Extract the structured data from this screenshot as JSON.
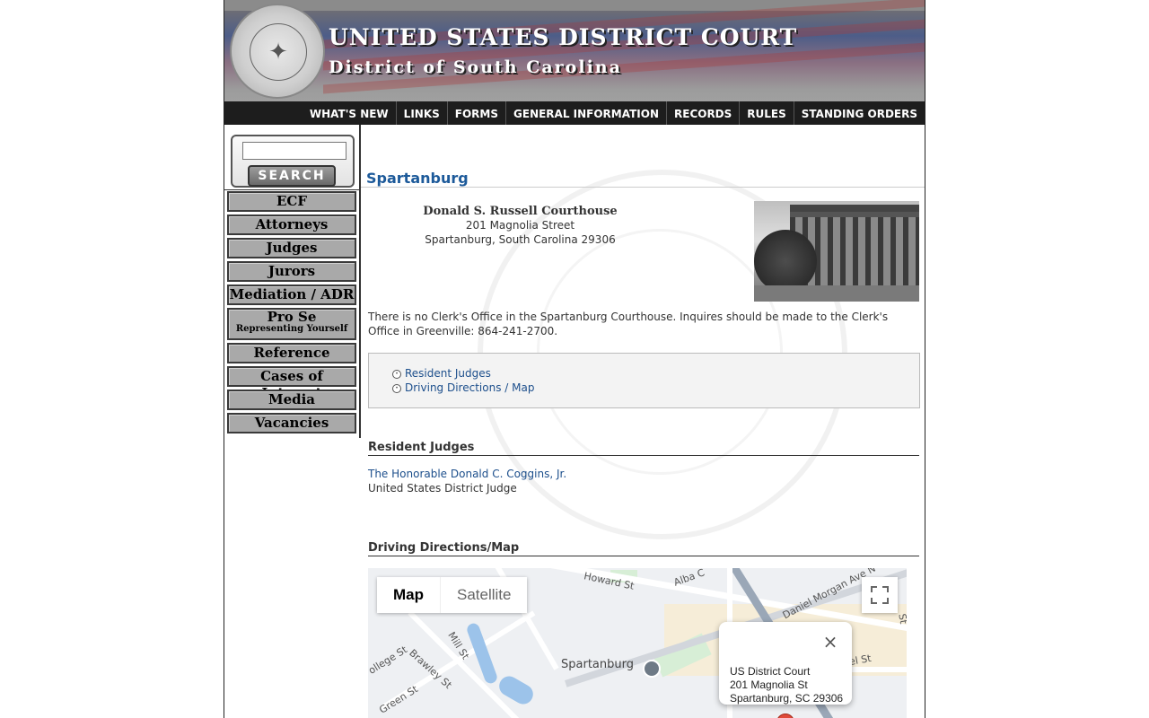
{
  "banner": {
    "title": "UNITED STATES DISTRICT COURT",
    "subtitle": "District of South Carolina",
    "seal_text": "UNITED STATES DISTRICT COURT · DISTRICT OF SOUTH CAROLINA"
  },
  "topnav": [
    "WHAT'S NEW",
    "LINKS",
    "FORMS",
    "GENERAL INFORMATION",
    "RECORDS",
    "RULES",
    "STANDING ORDERS"
  ],
  "search": {
    "placeholder": "",
    "button_label": "SEARCH"
  },
  "sidebar": {
    "items": [
      {
        "label": "ECF"
      },
      {
        "label": "Attorneys"
      },
      {
        "label": "Judges"
      },
      {
        "label": "Jurors"
      },
      {
        "label": "Mediation / ADR"
      },
      {
        "label": "Pro Se",
        "sub": "Representing Yourself"
      },
      {
        "label": "Reference"
      },
      {
        "label": "Cases of Interest"
      },
      {
        "label": "Media"
      },
      {
        "label": "Vacancies"
      }
    ]
  },
  "main": {
    "page_title": "Spartanburg",
    "courthouse": {
      "name": "Donald S. Russell Courthouse",
      "street": "201 Magnolia Street",
      "city": "Spartanburg, South Carolina 29306"
    },
    "note": "There is no Clerk's Office in the Spartanburg Courthouse. Inquires should be made to the Clerk's Office in Greenville: 864-241-2700.",
    "links": [
      "Resident Judges",
      "Driving Directions / Map"
    ],
    "resident_judges_heading": "Resident Judges",
    "judge": {
      "name": "The Honorable Donald C. Coggins, Jr.",
      "title": "United States District Judge"
    },
    "directions_heading": "Driving Directions/Map"
  },
  "map": {
    "controls": {
      "map": "Map",
      "satellite": "Satellite"
    },
    "labels": {
      "howard": "Howard St",
      "alba": "Alba C",
      "daniel": "Daniel Morgan Ave N",
      "spartanburg": "Spartanburg",
      "college": "ollege St",
      "brawley": "Brawley St",
      "mill": "Mill St",
      "green": "Green St",
      "st_right": "St",
      "el": "el St"
    },
    "popup": {
      "line1": "US District Court",
      "line2": "201 Magnolia St",
      "line3": "Spartanburg, SC 29306",
      "close": "×"
    }
  },
  "colors": {
    "link": "#1d4f8c",
    "title": "#1d5a9a",
    "nav_bg": "#1d1d1d",
    "sidebar_btn": "#a9a9a9"
  }
}
